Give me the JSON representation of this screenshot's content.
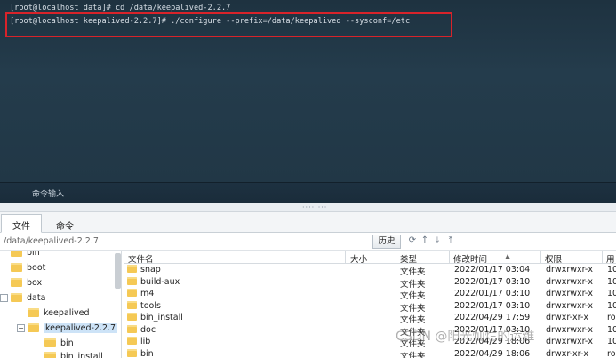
{
  "terminal": {
    "lines": [
      "[root@localhost data]# cd /data/keepalived-2.2.7",
      "[root@localhost keepalived-2.2.7]# ./configure --prefix=/data/keepalived --sysconf=/etc"
    ],
    "command_input_label": "命令输入",
    "highlight_color": "#d8232a"
  },
  "tabs": [
    {
      "label": "文件",
      "active": true
    },
    {
      "label": "命令",
      "active": false
    }
  ],
  "pathbar": {
    "path": "/data/keepalived-2.2.7",
    "history_label": "历史",
    "tool_icons": [
      "refresh-icon",
      "up-icon",
      "download-icon",
      "upload-icon"
    ]
  },
  "tree": {
    "items": [
      {
        "label": "bin"
      },
      {
        "label": "boot"
      },
      {
        "label": "box"
      },
      {
        "label": "data",
        "toggle": "−"
      },
      {
        "label": "keepalived"
      },
      {
        "label": "keepalived-2.2.7",
        "toggle": "−",
        "selected": true
      },
      {
        "label": "bin"
      },
      {
        "label": "bin_install"
      }
    ]
  },
  "filelist": {
    "columns": [
      "文件名",
      "大小",
      "类型",
      "修改时间",
      "权限",
      "用"
    ],
    "sort_indicator": "▲",
    "rows": [
      {
        "name": "snap",
        "type": "文件夹",
        "modified": "2022/01/17 03:04",
        "perm": "drwxrwxr-x",
        "owner": "10"
      },
      {
        "name": "build-aux",
        "type": "文件夹",
        "modified": "2022/01/17 03:10",
        "perm": "drwxrwxr-x",
        "owner": "10"
      },
      {
        "name": "m4",
        "type": "文件夹",
        "modified": "2022/01/17 03:10",
        "perm": "drwxrwxr-x",
        "owner": "10"
      },
      {
        "name": "tools",
        "type": "文件夹",
        "modified": "2022/01/17 03:10",
        "perm": "drwxrwxr-x",
        "owner": "10"
      },
      {
        "name": "bin_install",
        "type": "文件夹",
        "modified": "2022/04/29 17:59",
        "perm": "drwxr-xr-x",
        "owner": "ro"
      },
      {
        "name": "doc",
        "type": "文件夹",
        "modified": "2022/01/17 03:10",
        "perm": "drwxrwxr-x",
        "owner": "10"
      },
      {
        "name": "lib",
        "type": "文件夹",
        "modified": "2022/04/29 18:06",
        "perm": "drwxrwxr-x",
        "owner": "10"
      },
      {
        "name": "bin",
        "type": "文件夹",
        "modified": "2022/04/29 18:06",
        "perm": "drwxr-xr-x",
        "owner": "ro"
      }
    ]
  },
  "watermark": "CSDN @阳光灿烂的运维"
}
